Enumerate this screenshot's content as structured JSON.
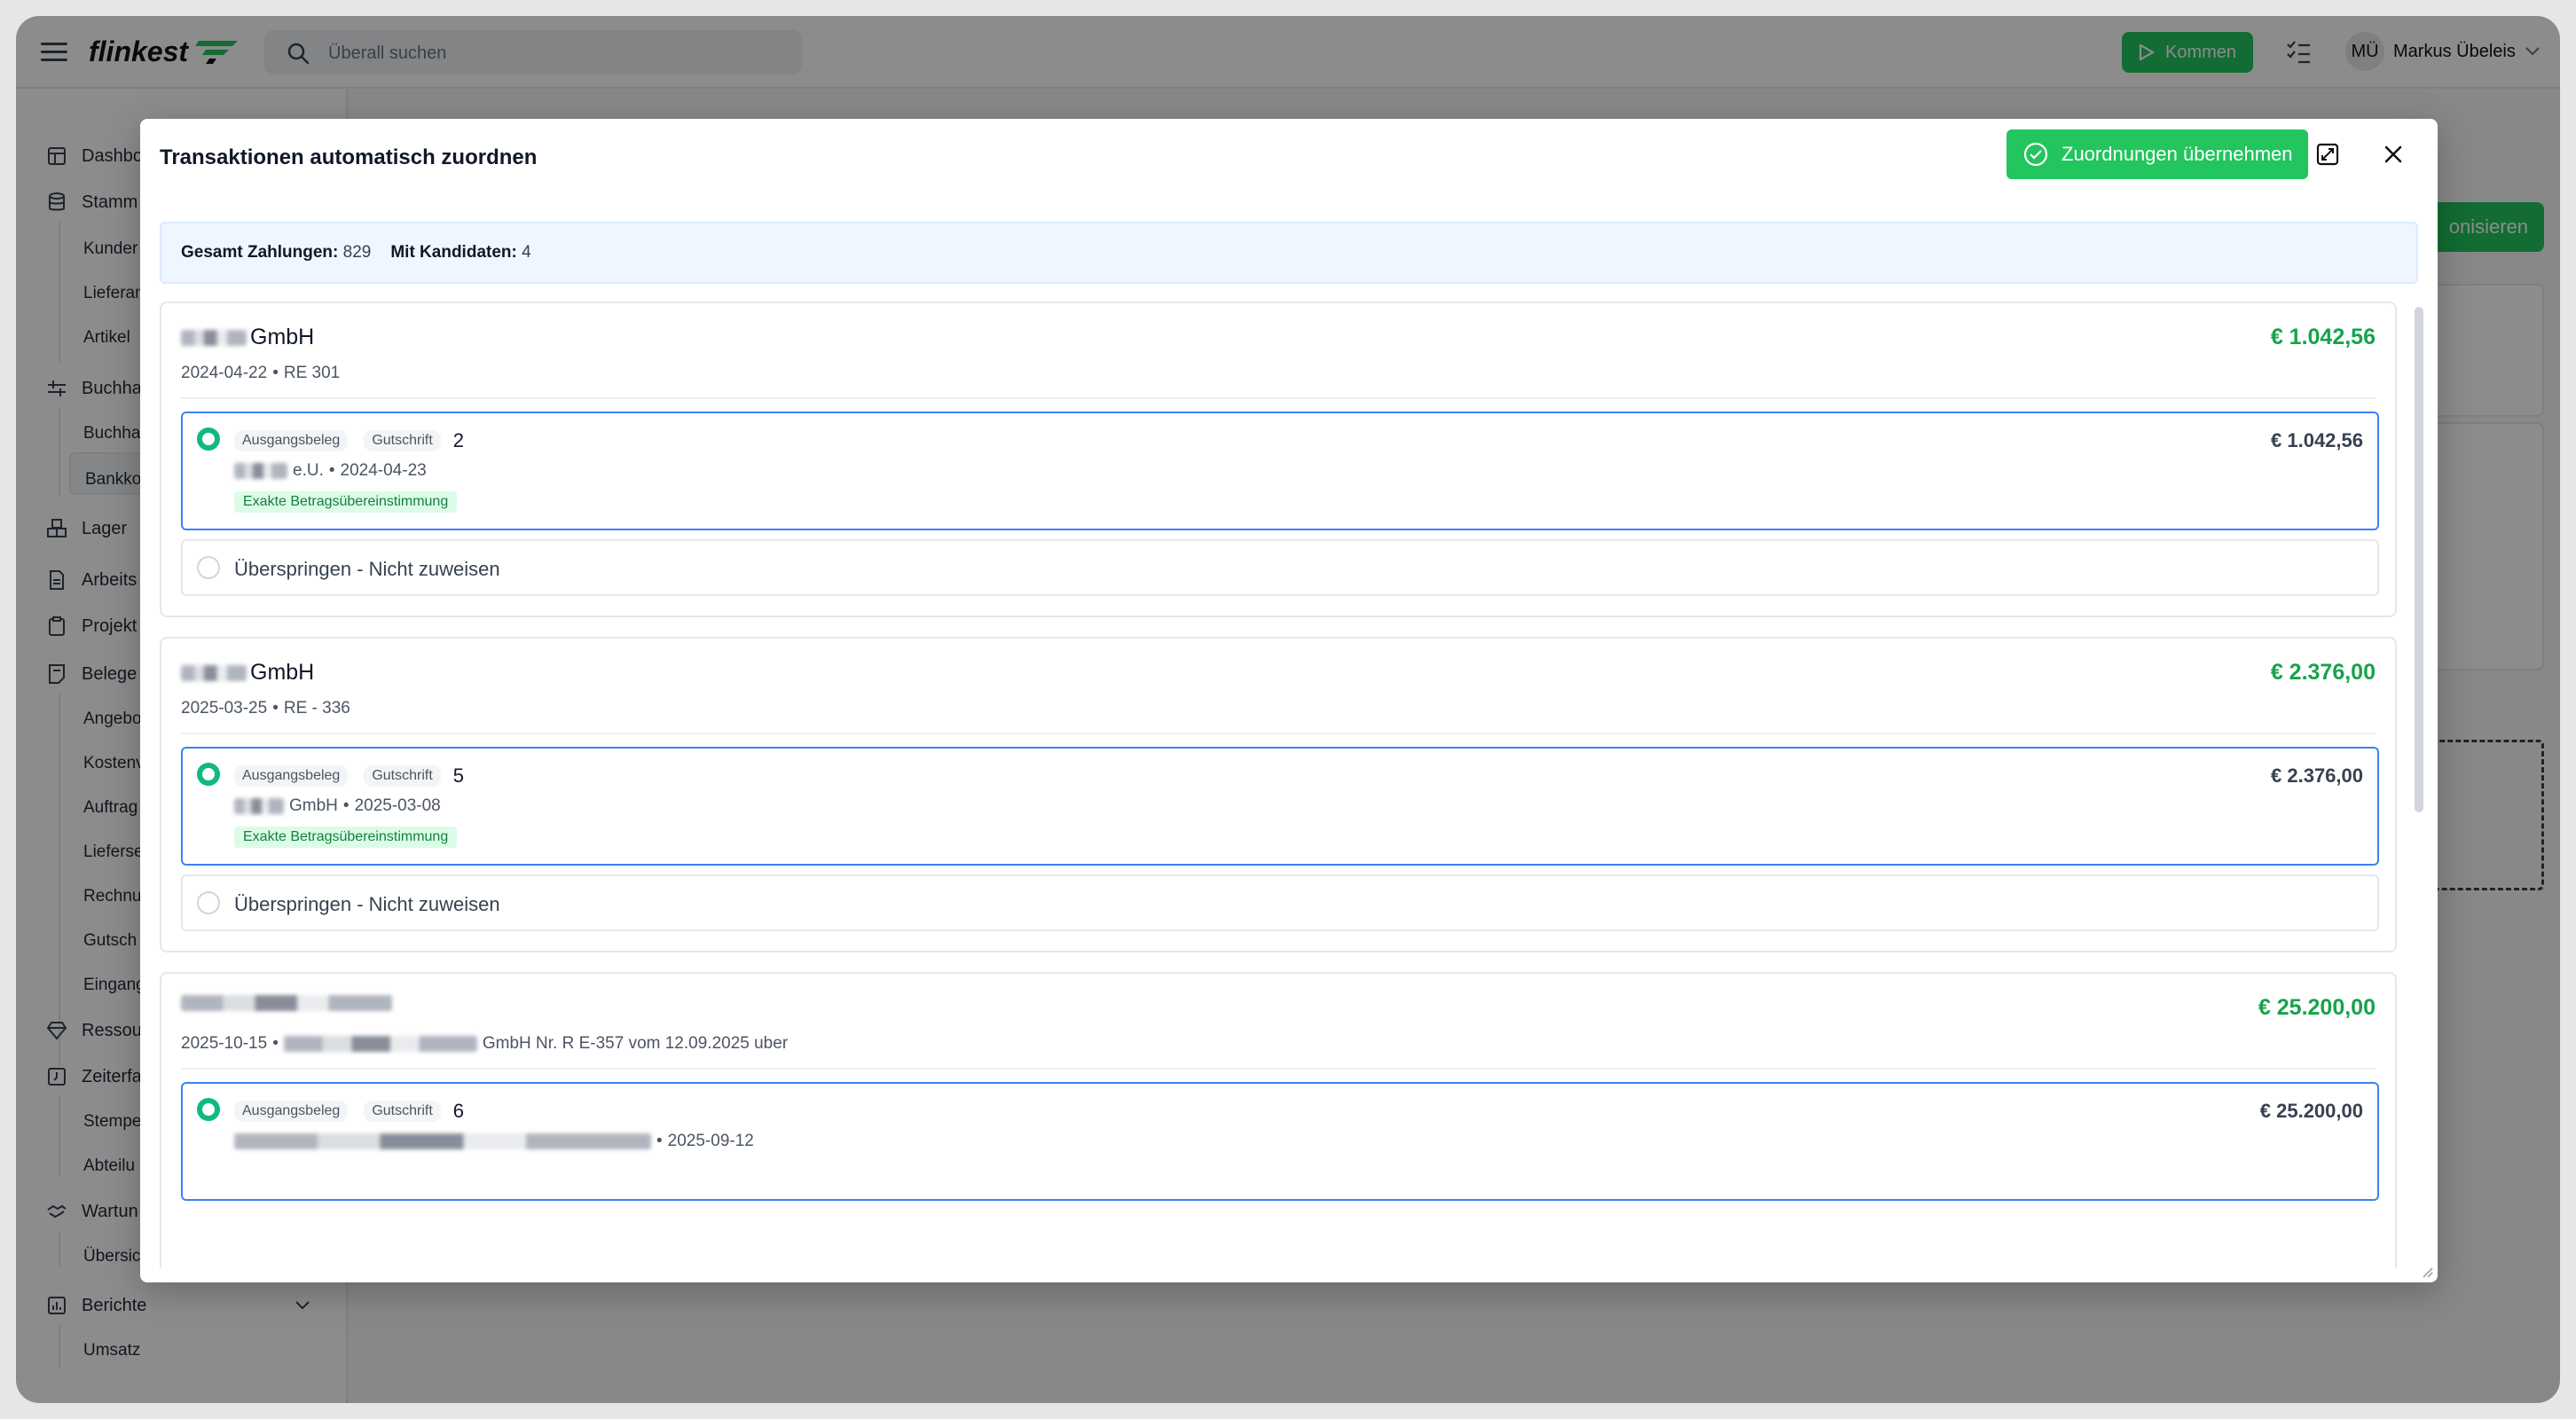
{
  "app": {
    "logo": "flinkest",
    "search_placeholder": "Überall suchen",
    "kommen_label": "Kommen",
    "user_initials": "MÜ",
    "user_name": "Markus Übeleis"
  },
  "sidebar": {
    "items": [
      {
        "label": "Dashbo"
      },
      {
        "label": "Stamm"
      },
      {
        "label": "Kunder"
      },
      {
        "label": "Lieferan"
      },
      {
        "label": "Artikel"
      },
      {
        "label": "Buchha"
      },
      {
        "label": "Buchha"
      },
      {
        "label": "Bankko"
      },
      {
        "label": "Lager"
      },
      {
        "label": "Arbeits"
      },
      {
        "label": "Projekt"
      },
      {
        "label": "Belege"
      },
      {
        "label": "Angebo"
      },
      {
        "label": "Kostenv"
      },
      {
        "label": "Auftrag"
      },
      {
        "label": "Lieferse"
      },
      {
        "label": "Rechnu"
      },
      {
        "label": "Gutsch"
      },
      {
        "label": "Eingang"
      },
      {
        "label": "Ressou"
      },
      {
        "label": "Zeiterfa"
      },
      {
        "label": "Stempe"
      },
      {
        "label": "Abteilu"
      },
      {
        "label": "Wartun"
      },
      {
        "label": "Übersic"
      },
      {
        "label": "Berichte"
      },
      {
        "label": "Umsatz"
      }
    ]
  },
  "background": {
    "green_button_label": "onisieren"
  },
  "modal": {
    "title": "Transaktionen automatisch zuordnen",
    "accept_label": "Zuordnungen übernehmen",
    "summary": {
      "total_label": "Gesamt Zahlungen:",
      "total_value": "829",
      "candidates_label": "Mit Kandidaten:",
      "candidates_value": "4"
    },
    "skip_label": "Überspringen - Nicht zuweisen",
    "transactions": [
      {
        "name": "GmbH",
        "date": "2024-04-22",
        "reference": "RE 301",
        "amount": "€ 1.042,56",
        "candidate": {
          "badge_type": "Ausgangsbeleg",
          "badge_kind": "Gutschrift",
          "number": "2",
          "party": "e.U.",
          "date": "2024-04-23",
          "match": "Exakte Betragsübereinstimmung",
          "amount": "€ 1.042,56"
        }
      },
      {
        "name": "GmbH",
        "date": "2025-03-25",
        "reference": "RE - 336",
        "amount": "€ 2.376,00",
        "candidate": {
          "badge_type": "Ausgangsbeleg",
          "badge_kind": "Gutschrift",
          "number": "5",
          "party": "GmbH",
          "date": "2025-03-08",
          "match": "Exakte Betragsübereinstimmung",
          "amount": "€ 2.376,00"
        }
      },
      {
        "name": "",
        "date": "2025-10-15",
        "reference": "GmbH Nr. R E-357 vom 12.09.2025 uber",
        "amount": "€ 25.200,00",
        "candidate": {
          "badge_type": "Ausgangsbeleg",
          "badge_kind": "Gutschrift",
          "number": "6",
          "party": "",
          "date": "2025-09-12",
          "match": "",
          "amount": "€ 25.200,00"
        }
      }
    ]
  }
}
